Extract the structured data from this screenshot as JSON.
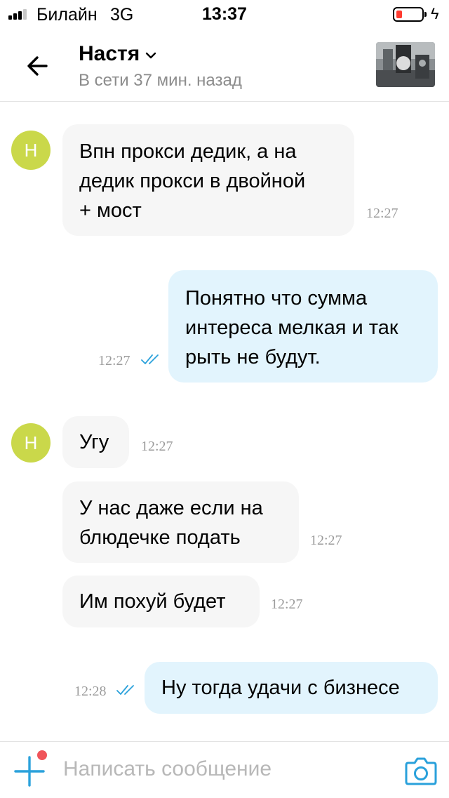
{
  "status_bar": {
    "carrier": "Билайн",
    "network": "3G",
    "time": "13:37",
    "charging_symbol": "ϟ"
  },
  "header": {
    "contact_name": "Настя",
    "last_seen": "В сети 37 мин. назад"
  },
  "messages": [
    {
      "direction": "in",
      "avatar_letter": "Н",
      "lines": [
        "Впн прокси дедик, а на",
        "дедик прокси в двойной",
        "+ мост"
      ],
      "time": "12:27"
    },
    {
      "direction": "out",
      "lines": [
        "Понятно что сумма",
        "интереса мелкая и так",
        "рыть не будут."
      ],
      "time": "12:27",
      "status": "read"
    },
    {
      "direction": "in",
      "avatar_letter": "Н",
      "lines": [
        "Угу"
      ],
      "time": "12:27"
    },
    {
      "direction": "in",
      "lines": [
        "У нас даже если на",
        "блюдечке подать"
      ],
      "time": "12:27"
    },
    {
      "direction": "in",
      "lines": [
        "Им похуй будет"
      ],
      "time": "12:27"
    },
    {
      "direction": "out",
      "lines": [
        "Ну тогда удачи с бизнесе"
      ],
      "time": "12:28",
      "status": "read"
    }
  ],
  "composer": {
    "placeholder": "Написать сообщение",
    "value": ""
  },
  "colors": {
    "accent": "#2aa1db",
    "avatar": "#cad84a",
    "incoming_bubble": "#f6f6f6",
    "outgoing_bubble": "#e2f4fd",
    "notification_dot": "#f0545a"
  },
  "icons": {
    "back": "arrow-left-icon",
    "chevron": "chevron-down-icon",
    "read_receipt": "double-check-icon",
    "add": "plus-icon",
    "camera": "camera-icon"
  }
}
